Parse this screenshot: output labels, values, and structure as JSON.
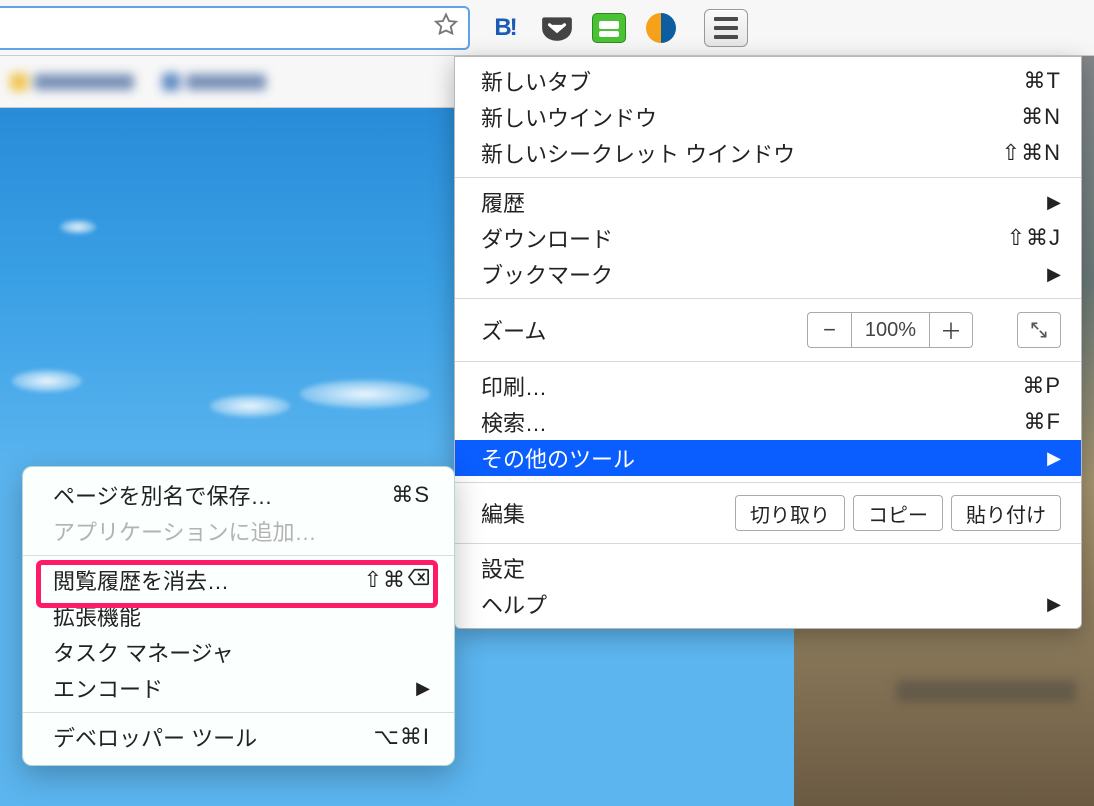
{
  "toolbar": {
    "extensions": {
      "hatena_label": "B!",
      "pocket_name": "pocket-icon",
      "roboform_name": "roboform-icon",
      "similarweb_name": "similarweb-icon"
    }
  },
  "main_menu": {
    "new_tab": {
      "label": "新しいタブ",
      "shortcut": "⌘T"
    },
    "new_window": {
      "label": "新しいウインドウ",
      "shortcut": "⌘N"
    },
    "new_incognito": {
      "label": "新しいシークレット ウインドウ",
      "shortcut": "⇧⌘N"
    },
    "history": {
      "label": "履歴",
      "arrow": "▶"
    },
    "downloads": {
      "label": "ダウンロード",
      "shortcut": "⇧⌘J"
    },
    "bookmarks": {
      "label": "ブックマーク",
      "arrow": "▶"
    },
    "zoom": {
      "label": "ズーム",
      "value": "100%",
      "minus": "−",
      "plus": "＋"
    },
    "print": {
      "label": "印刷…",
      "shortcut": "⌘P"
    },
    "find": {
      "label": "検索…",
      "shortcut": "⌘F"
    },
    "more_tools": {
      "label": "その他のツール",
      "arrow": "▶"
    },
    "edit": {
      "label": "編集",
      "cut": "切り取り",
      "copy": "コピー",
      "paste": "貼り付け"
    },
    "settings": {
      "label": "設定"
    },
    "help": {
      "label": "ヘルプ",
      "arrow": "▶"
    }
  },
  "submenu": {
    "save_as": {
      "label": "ページを別名で保存…",
      "shortcut": "⌘S"
    },
    "add_to_app": {
      "label": "アプリケーションに追加…"
    },
    "clear_browsing": {
      "label": "閲覧履歴を消去…",
      "shortcut": "⇧⌘"
    },
    "extensions": {
      "label": "拡張機能"
    },
    "task_manager": {
      "label": "タスク マネージャ"
    },
    "encoding": {
      "label": "エンコード",
      "arrow": "▶"
    },
    "devtools": {
      "label": "デベロッパー ツール",
      "shortcut": "⌥⌘I"
    }
  }
}
